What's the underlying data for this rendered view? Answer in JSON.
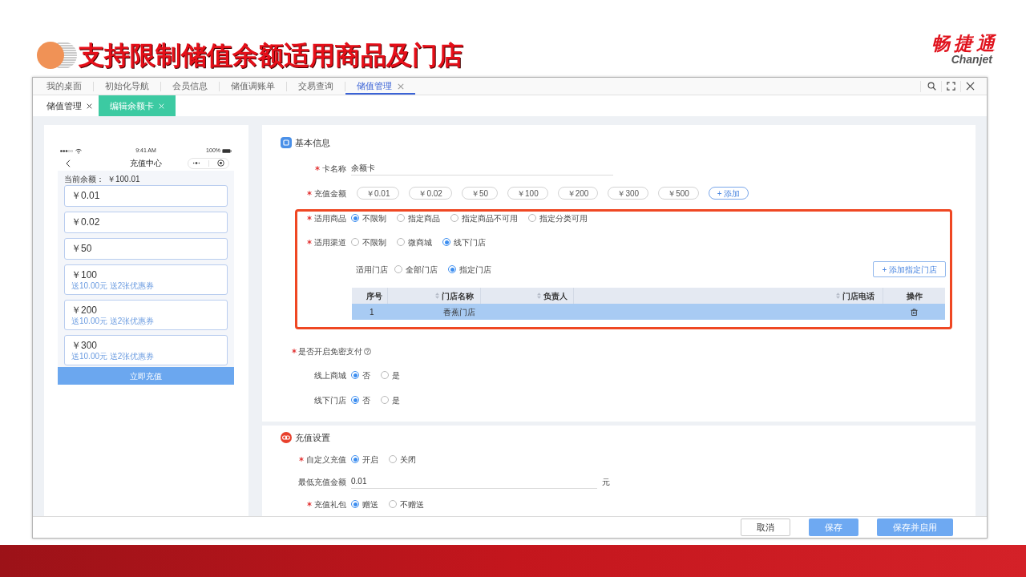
{
  "slide": {
    "title": "支持限制储值余额适用商品及门店",
    "logo": {
      "mark": "畅捷通",
      "wordmark": "Chanjet"
    }
  },
  "window": {
    "tabs": [
      {
        "label": "我的桌面",
        "selected": false,
        "closable": false
      },
      {
        "label": "初始化导航",
        "selected": false,
        "closable": false
      },
      {
        "label": "会员信息",
        "selected": false,
        "closable": false
      },
      {
        "label": "储值调账单",
        "selected": false,
        "closable": false
      },
      {
        "label": "交易查询",
        "selected": false,
        "closable": false
      },
      {
        "label": "储值管理",
        "selected": true,
        "closable": true
      }
    ],
    "subtabs": [
      {
        "label": "储值管理",
        "selected": false
      },
      {
        "label": "编辑余额卡",
        "selected": true
      }
    ]
  },
  "phone_preview": {
    "time": "9:41 AM",
    "battery": "100%",
    "title": "充值中心",
    "balance_label": "当前余额：",
    "balance": "￥100.01",
    "options": [
      {
        "amount": "￥0.01"
      },
      {
        "amount": "￥0.02"
      },
      {
        "amount": "￥50"
      },
      {
        "amount": "￥100",
        "bonus": "送10.00元 送2张优惠券"
      },
      {
        "amount": "￥200",
        "bonus": "送10.00元 送2张优惠券"
      },
      {
        "amount": "￥300",
        "bonus": "送10.00元 送2张优惠券"
      }
    ],
    "button": "立即充值"
  },
  "basic_info": {
    "title": "基本信息",
    "fields": [
      {
        "kind": "text",
        "label": "卡名称",
        "required": true,
        "value": "余额卡"
      },
      {
        "kind": "chips",
        "label": "充值金额",
        "required": true,
        "chips": [
          "￥0.01",
          "￥0.02",
          "￥50",
          "￥100",
          "￥200",
          "￥300",
          "￥500"
        ],
        "add_button": "+ 添加"
      }
    ],
    "highlight_box": {
      "fields": [
        {
          "kind": "radio",
          "label": "适用商品",
          "required": true,
          "options": [
            {
              "label": "不限制",
              "selected": true
            },
            {
              "label": "指定商品",
              "selected": false
            },
            {
              "label": "指定商品不可用",
              "selected": false
            },
            {
              "label": "指定分类可用",
              "selected": false
            }
          ]
        },
        {
          "kind": "radio",
          "label": "适用渠道",
          "required": true,
          "options": [
            {
              "label": "不限制",
              "selected": false
            },
            {
              "label": "微商城",
              "selected": false
            },
            {
              "label": "线下门店",
              "selected": true
            }
          ]
        }
      ],
      "store_picker": {
        "label": "适用门店",
        "options": [
          {
            "label": "全部门店",
            "selected": false
          },
          {
            "label": "指定门店",
            "selected": true
          }
        ],
        "add_button": "+ 添加指定门店",
        "table": {
          "columns": [
            {
              "label": "序号",
              "sortable": false
            },
            {
              "label": "门店名称",
              "sortable": true
            },
            {
              "label": "负责人",
              "sortable": true
            },
            {
              "label": "门店电话",
              "sortable": true
            },
            {
              "label": "操作",
              "sortable": false
            }
          ],
          "rows": [
            {
              "number": "1",
              "store_name": "香蕉门店",
              "selected": true
            }
          ]
        }
      }
    },
    "password_free": {
      "label": "是否开启免密支付",
      "required": true,
      "fields": [
        {
          "kind": "radio",
          "label": "线上商城",
          "required": false,
          "options": [
            {
              "label": "否",
              "selected": true
            },
            {
              "label": "是",
              "selected": false
            }
          ]
        },
        {
          "kind": "radio",
          "label": "线下门店",
          "required": false,
          "options": [
            {
              "label": "否",
              "selected": true
            },
            {
              "label": "是",
              "selected": false
            }
          ]
        }
      ]
    }
  },
  "recharge_settings": {
    "title": "充值设置",
    "fields": [
      {
        "kind": "radio",
        "label": "自定义充值",
        "required": true,
        "options": [
          {
            "label": "开启",
            "selected": true
          },
          {
            "label": "关闭",
            "selected": false
          }
        ]
      },
      {
        "kind": "text",
        "label": "最低充值金额",
        "required": false,
        "value": "0.01",
        "suffix": "元"
      },
      {
        "kind": "radio",
        "label": "充值礼包",
        "required": true,
        "options": [
          {
            "label": "赠送",
            "selected": true
          },
          {
            "label": "不赠送",
            "selected": false
          }
        ]
      }
    ]
  },
  "actions": [
    {
      "label": "取消",
      "kind": "default"
    },
    {
      "label": "保存",
      "kind": "primary"
    },
    {
      "label": "保存并启用",
      "kind": "primary"
    }
  ]
}
